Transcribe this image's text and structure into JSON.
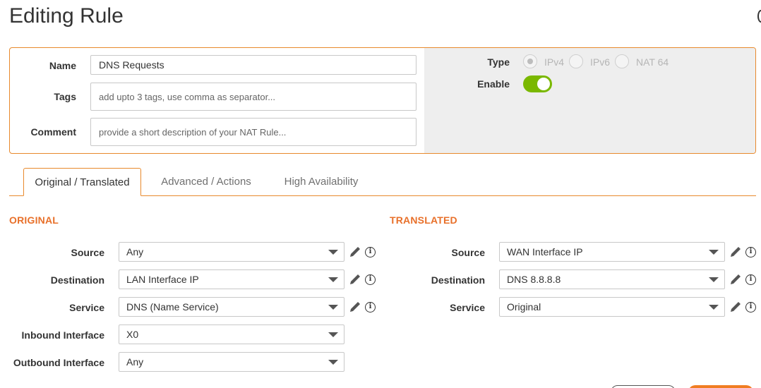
{
  "page": {
    "title": "Editing Rule"
  },
  "rule": {
    "name_label": "Name",
    "name_value": "DNS Requests",
    "tags_label": "Tags",
    "tags_placeholder": "add upto 3 tags, use comma as separator...",
    "comment_label": "Comment",
    "comment_placeholder": "provide a short description of your NAT Rule...",
    "type_label": "Type",
    "type_options": [
      "IPv4",
      "IPv6",
      "NAT 64"
    ],
    "type_selected": "IPv4",
    "enable_label": "Enable",
    "enabled": true
  },
  "tabs": [
    {
      "label": "Original / Translated",
      "active": true
    },
    {
      "label": "Advanced / Actions",
      "active": false
    },
    {
      "label": "High Availability",
      "active": false
    }
  ],
  "original": {
    "heading": "ORIGINAL",
    "rows": [
      {
        "label": "Source",
        "value": "Any"
      },
      {
        "label": "Destination",
        "value": "LAN Interface IP"
      },
      {
        "label": "Service",
        "value": "DNS (Name Service)"
      },
      {
        "label": "Inbound Interface",
        "value": "X0"
      },
      {
        "label": "Outbound Interface",
        "value": "Any"
      }
    ]
  },
  "translated": {
    "heading": "TRANSLATED",
    "rows": [
      {
        "label": "Source",
        "value": "WAN Interface IP"
      },
      {
        "label": "Destination",
        "value": "DNS 8.8.8.8"
      },
      {
        "label": "Service",
        "value": "Original"
      }
    ]
  },
  "icons": {
    "edit": "pencil-icon",
    "info": "info-circle-icon",
    "caret": "chevron-down-icon"
  },
  "colors": {
    "accent": "#e8892c",
    "heading": "#e8702a",
    "toggle_on": "#7ab800"
  },
  "glyphs": {
    "info": "i"
  }
}
